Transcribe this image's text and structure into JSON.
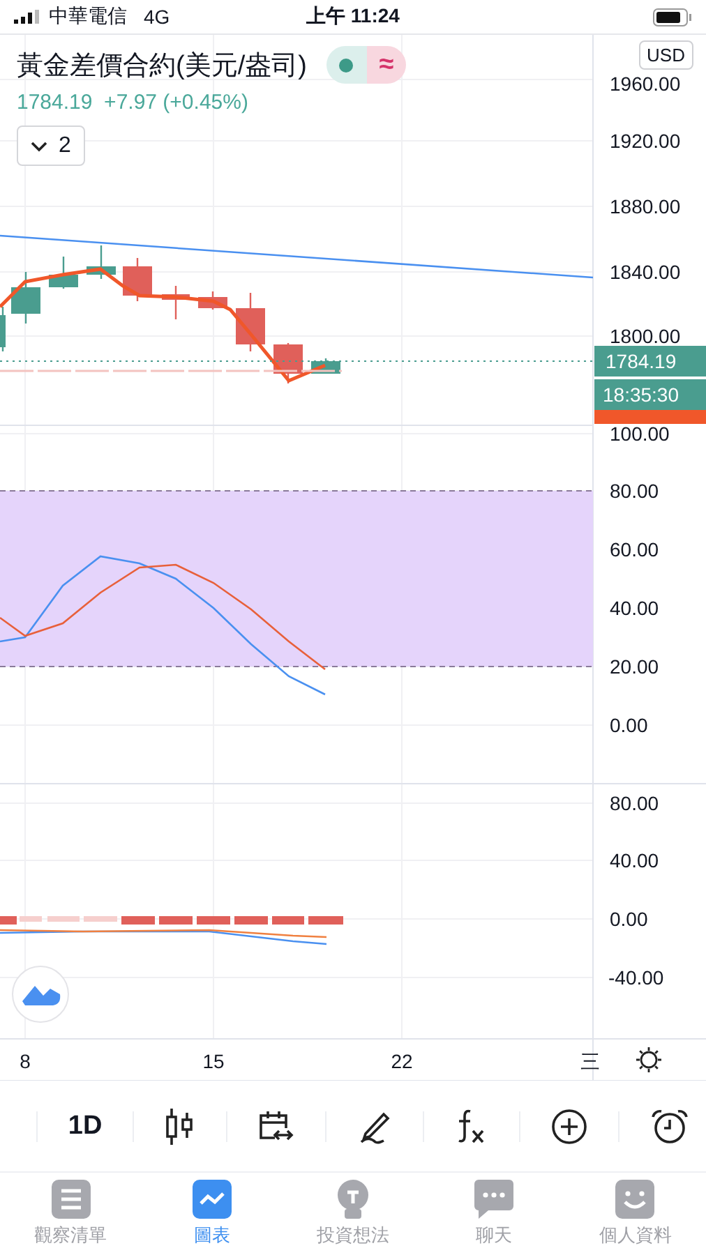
{
  "status_bar": {
    "carrier": "中華電信",
    "network": "4G",
    "time": "上午 11:24"
  },
  "symbol": {
    "title": "黃金差價合約(美元/盎司)",
    "approx_glyph": "≈",
    "price": "1784.19",
    "change": "+7.97 (+0.45%)",
    "currency": "USD",
    "indicator_count": "2"
  },
  "price_axis": {
    "labels": [
      "1960.00",
      "1920.00",
      "1880.00",
      "1840.00",
      "1800.00"
    ],
    "last_price": "1784.19",
    "countdown": "18:35:30"
  },
  "oscillator_axis": {
    "labels": [
      "100.00",
      "80.00",
      "60.00",
      "40.00",
      "20.00",
      "0.00"
    ]
  },
  "macd_axis": {
    "labels": [
      "80.00",
      "40.00",
      "0.00",
      "-40.00"
    ]
  },
  "time_axis": {
    "labels": [
      "8",
      "15",
      "22",
      "三"
    ]
  },
  "toolbar": {
    "interval": "1D"
  },
  "tabs": [
    {
      "label": "觀察清單",
      "selected": false
    },
    {
      "label": "圖表",
      "selected": true
    },
    {
      "label": "投資想法",
      "selected": false
    },
    {
      "label": "聊天",
      "selected": false
    },
    {
      "label": "個人資料",
      "selected": false
    }
  ]
}
